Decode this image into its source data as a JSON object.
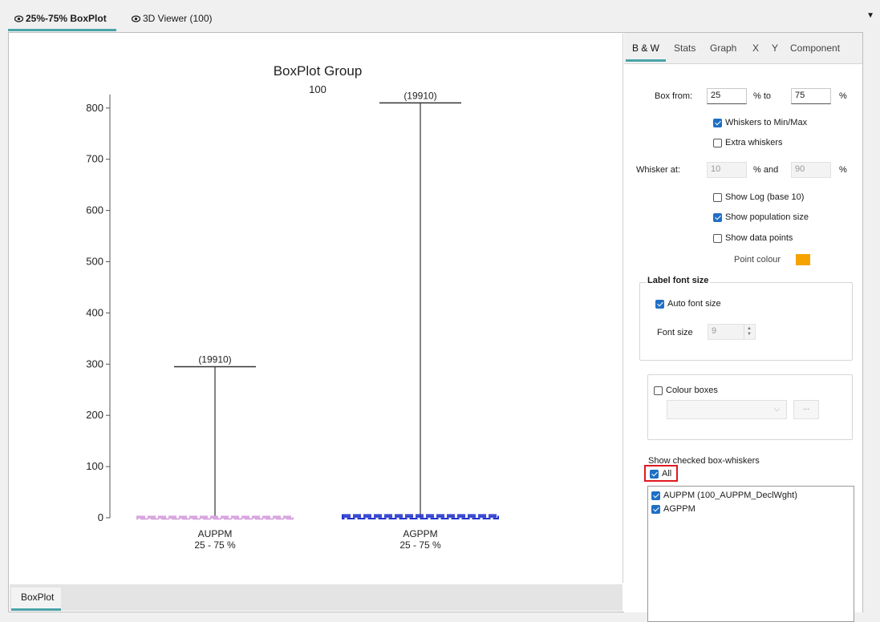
{
  "top_tabs": [
    {
      "label": "25%-75% BoxPlot",
      "active": true,
      "icon": "eye-icon"
    },
    {
      "label": "3D Viewer (100)",
      "active": false,
      "icon": "eye-icon"
    }
  ],
  "bottom_tab": "BoxPlot",
  "side_tabs": [
    "B & W",
    "Stats",
    "Graph",
    "X",
    "Y",
    "Component"
  ],
  "settings": {
    "box_from_label": "Box from:",
    "box_from": "25",
    "to_label": "% to",
    "box_to": "75",
    "pct": "%",
    "whiskers_minmax": {
      "label": "Whiskers to Min/Max",
      "checked": true
    },
    "extra_whiskers": {
      "label": "Extra whiskers",
      "checked": false
    },
    "whisker_at_label": "Whisker at:",
    "whisker_low": "10",
    "and_label": "% and",
    "whisker_high": "90",
    "show_log": {
      "label": "Show Log (base 10)",
      "checked": false
    },
    "show_population": {
      "label": "Show population size",
      "checked": true
    },
    "show_points": {
      "label": "Show data points",
      "checked": false
    },
    "point_colour_label": "Point colour",
    "point_colour": "#f5a300",
    "label_font_group": "Label font size",
    "auto_font": {
      "label": "Auto font size",
      "checked": true
    },
    "font_size_label": "Font size",
    "font_size": "9",
    "colour_boxes": {
      "label": "Colour boxes",
      "checked": false
    },
    "ellipsis": "...",
    "show_checked_label": "Show checked box-whiskers",
    "all": {
      "label": "All",
      "checked": true
    },
    "items": [
      {
        "label": "AUPPM (100_AUPPM_DeclWght)",
        "checked": true
      },
      {
        "label": "AGPPM",
        "checked": true
      }
    ]
  },
  "chart_data": {
    "type": "box",
    "title": "BoxPlot Group",
    "subtitle": "100",
    "ylim": [
      0,
      820
    ],
    "yticks": [
      0,
      100,
      200,
      300,
      400,
      500,
      600,
      700,
      800
    ],
    "categories": [
      "AUPPM",
      "AGPPM"
    ],
    "category_sublabels": [
      "25 - 75 %",
      "25 - 75 %"
    ],
    "series": [
      {
        "name": "AUPPM",
        "min": 0,
        "q1": 0,
        "median": 0,
        "q3": 1,
        "max": 295,
        "n_label": "(19910)",
        "color": "#d9a6e0"
      },
      {
        "name": "AGPPM",
        "min": 0,
        "q1": 0,
        "median": 2,
        "q3": 4,
        "max": 810,
        "n_label": "(19910)",
        "color": "#2233cc"
      }
    ]
  }
}
